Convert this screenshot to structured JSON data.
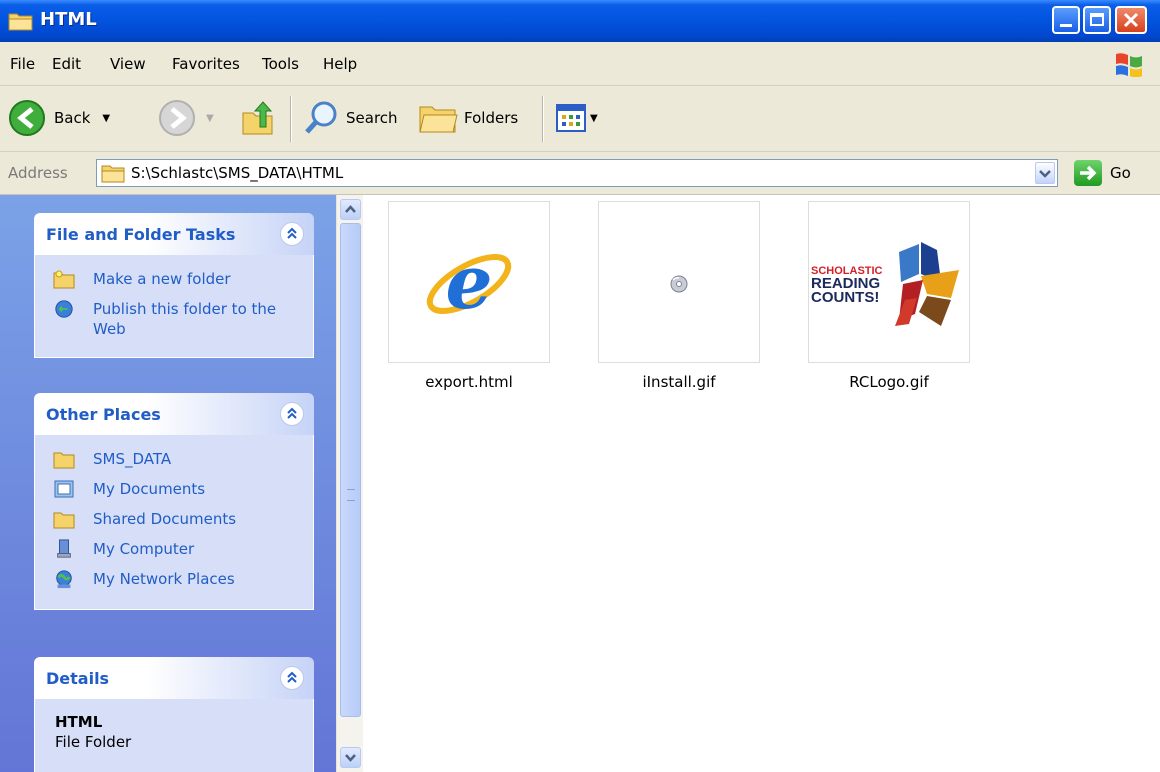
{
  "window": {
    "title": "HTML"
  },
  "menu": {
    "items": [
      "File",
      "Edit",
      "View",
      "Favorites",
      "Tools",
      "Help"
    ]
  },
  "toolbar": {
    "back_label": "Back",
    "search_label": "Search",
    "folders_label": "Folders"
  },
  "address": {
    "label": "Address",
    "path": "S:\\Schlastc\\SMS_DATA\\HTML",
    "go_label": "Go"
  },
  "taskpane": {
    "file_tasks": {
      "title": "File and Folder Tasks",
      "items": [
        "Make a new folder",
        "Publish this folder to the Web"
      ]
    },
    "other_places": {
      "title": "Other Places",
      "items": [
        "SMS_DATA",
        "My Documents",
        "Shared Documents",
        "My Computer",
        "My Network Places"
      ]
    },
    "details": {
      "title": "Details",
      "name": "HTML",
      "type": "File Folder"
    }
  },
  "files": [
    {
      "name": "export.html",
      "icon": "ie-icon"
    },
    {
      "name": "iInstall.gif",
      "icon": "cd-icon"
    },
    {
      "name": "RCLogo.gif",
      "icon": "logo-thumbnail",
      "logo_text": [
        "SCHOLASTIC",
        "READING",
        "COUNTS!"
      ]
    }
  ],
  "colors": {
    "title_bar": "#0355e0",
    "task_pane": "#7ba2e7",
    "link_blue": "#215dc6"
  }
}
